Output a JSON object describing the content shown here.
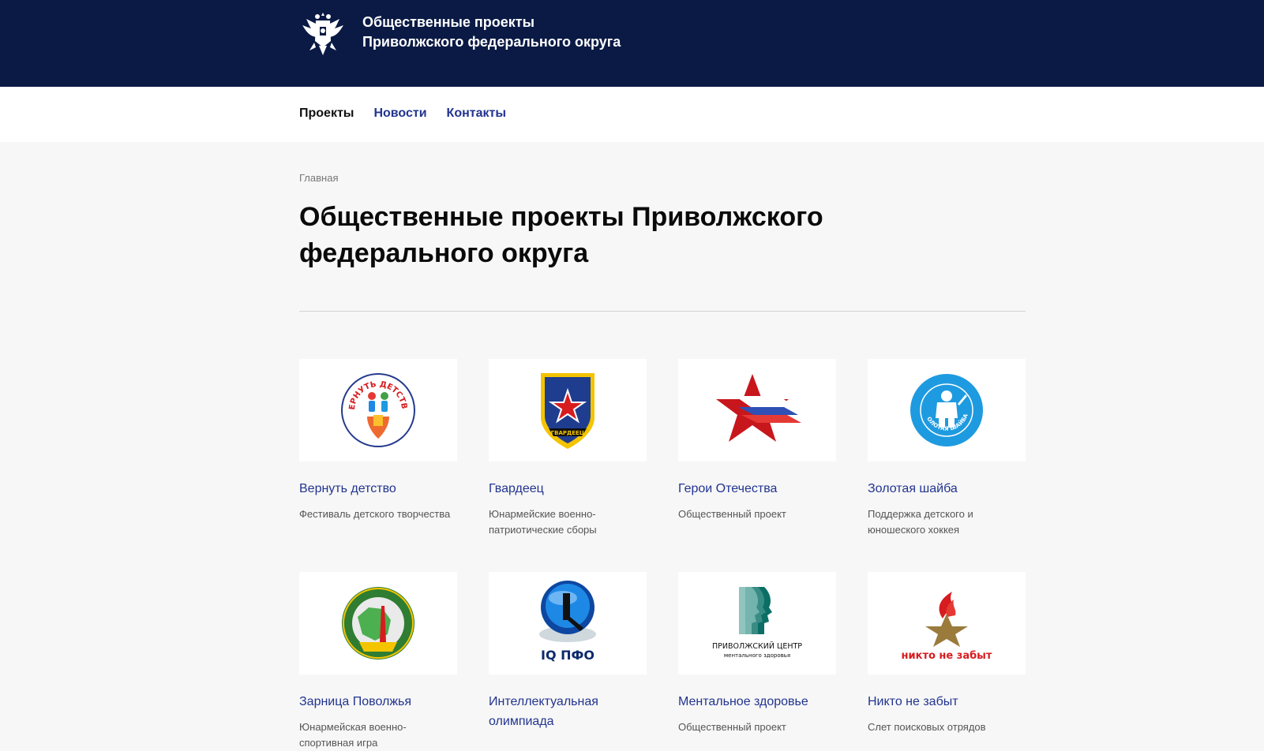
{
  "header": {
    "title_line1": "Общественные проекты",
    "title_line2": "Приволжского федерального округа",
    "emblem_icon": "double-headed-eagle-emblem-icon",
    "background": "#0a1a45"
  },
  "nav": {
    "items": [
      {
        "label": "Проекты",
        "active": true
      },
      {
        "label": "Новости",
        "active": false
      },
      {
        "label": "Контакты",
        "active": false
      }
    ]
  },
  "breadcrumb": "Главная",
  "page_title": "Общественные проекты Приволжского федерального округа",
  "projects": [
    {
      "title": "Вернуть детство",
      "desc": "Фестиваль детского творчества",
      "logo_icon": "vernut-detstvo-logo-icon",
      "logo_text": "ВЕРНУТЬ ДЕТСТВО"
    },
    {
      "title": "Гвардеец",
      "desc": "Юнармейские военно-патриотические сборы",
      "logo_icon": "gvardeets-shield-logo-icon",
      "logo_text": "ГВАРДЕЕЦ"
    },
    {
      "title": "Герои Отечества",
      "desc": "Общественный проект",
      "logo_icon": "red-star-flag-logo-icon"
    },
    {
      "title": "Золотая шайба",
      "desc": "Поддержка детского и юношеского хоккея",
      "logo_icon": "golden-puck-hockey-logo-icon",
      "logo_text": "ЗОЛОТАЯ ШАЙБА"
    },
    {
      "title": "Зарница Поволжья",
      "desc": "Юнармейская военно-спортивная игра",
      "logo_icon": "zarnitsa-map-logo-icon"
    },
    {
      "title": "Интеллектуальная олимпиада",
      "desc": "",
      "logo_icon": "iq-pfo-logo-icon",
      "logo_text": "IQ ПФО"
    },
    {
      "title": "Ментальное здоровье",
      "desc": "Общественный проект",
      "logo_icon": "mental-health-heads-logo-icon",
      "logo_text": "ПРИВОЛЖСКИЙ ЦЕНТР",
      "logo_subtext": "ментального здоровья"
    },
    {
      "title": "Никто не забыт",
      "desc": "Слет поисковых отрядов",
      "logo_icon": "eternal-flame-star-logo-icon",
      "logo_text": "никто не забыт"
    }
  ],
  "colors": {
    "link": "#22348f",
    "accent_red": "#d71c20",
    "accent_blue": "#1e9be0",
    "gold": "#9a7b3c"
  }
}
